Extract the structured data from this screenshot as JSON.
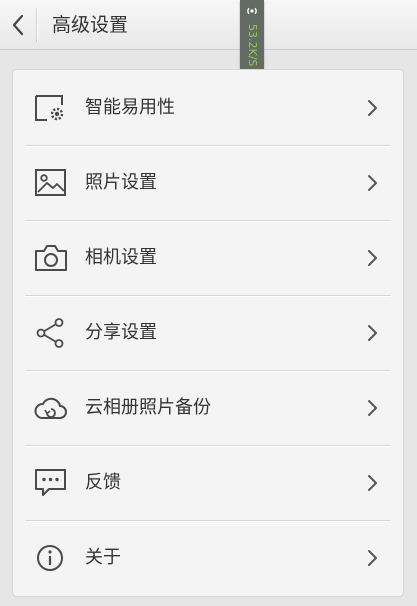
{
  "header": {
    "title": "高级设置",
    "back_icon": "chevron-left-icon"
  },
  "status": {
    "net_speed": "53.2K/S",
    "accent_color": "#8bd04b"
  },
  "menu": {
    "items": [
      {
        "label": "智能易用性",
        "icon": "smart-gear-icon"
      },
      {
        "label": "照片设置",
        "icon": "picture-icon"
      },
      {
        "label": "相机设置",
        "icon": "camera-icon"
      },
      {
        "label": "分享设置",
        "icon": "share-icon"
      },
      {
        "label": "云相册照片备份",
        "icon": "cloud-sync-icon"
      },
      {
        "label": "反馈",
        "icon": "chat-bubble-icon"
      },
      {
        "label": "关于",
        "icon": "info-icon"
      }
    ]
  }
}
